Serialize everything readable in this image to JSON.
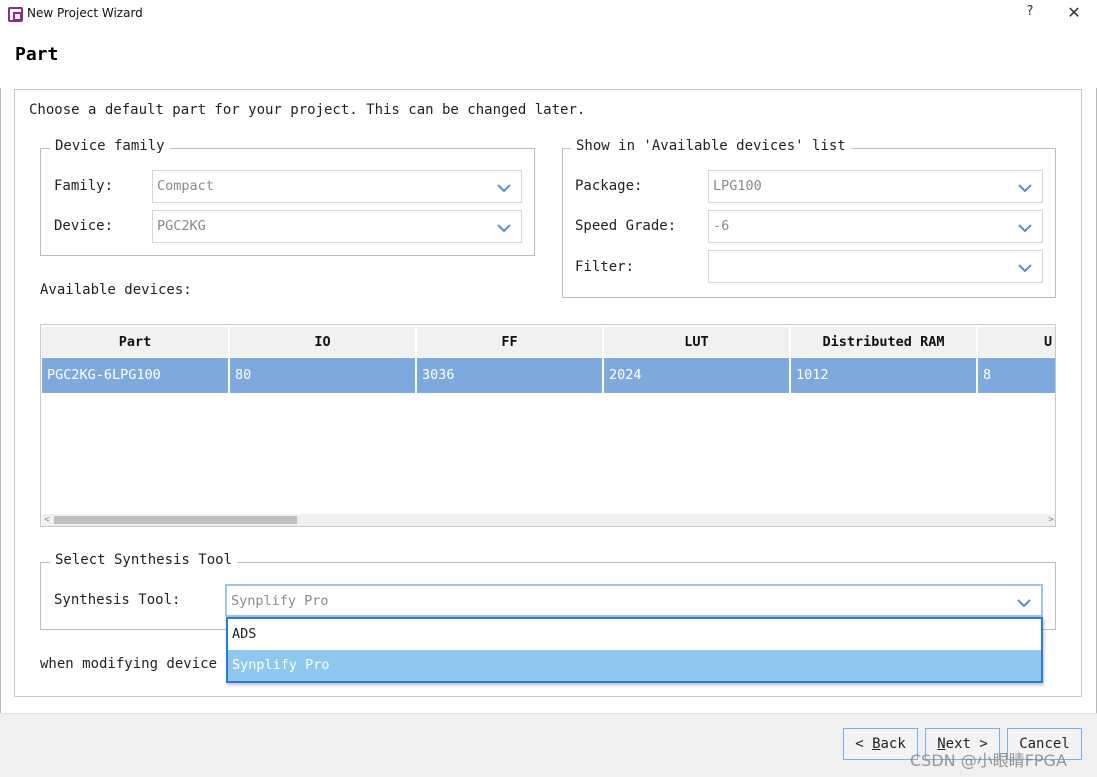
{
  "window": {
    "title": "New Project Wizard",
    "help_label": "?",
    "close_label": "✕"
  },
  "page": {
    "title": "Part",
    "description": "Choose a default part for your project. This can be changed later."
  },
  "device_family": {
    "legend": "Device family",
    "family_label": "Family:",
    "family_value": "Compact",
    "device_label": "Device:",
    "device_value": "PGC2KG"
  },
  "filters": {
    "legend": "Show in 'Available devices' list",
    "package_label": "Package:",
    "package_value": "LPG100",
    "speed_label": "Speed Grade:",
    "speed_value": "-6",
    "filter_label": "Filter:",
    "filter_value": ""
  },
  "devices": {
    "label": "Available devices:",
    "columns": [
      "Part",
      "IO",
      "FF",
      "LUT",
      "Distributed RAM",
      "U"
    ],
    "rows": [
      [
        "PGC2KG-6LPG100",
        "80",
        "3036",
        "2024",
        "1012",
        "8"
      ]
    ],
    "scroll_left": "<",
    "scroll_right": ">"
  },
  "synthesis": {
    "legend": "Select Synthesis Tool",
    "tool_label": "Synthesis Tool:",
    "tool_value": "Synplify Pro",
    "options": [
      "ADS",
      "Synplify Pro"
    ],
    "selected_option": "Synplify Pro"
  },
  "footnote": "when modifying device",
  "buttons": {
    "back_prefix": "< ",
    "back_mnemonic": "B",
    "back_rest": "ack",
    "next_mnemonic": "N",
    "next_rest": "ext >",
    "cancel_label": "Cancel"
  },
  "watermark": "CSDN @小眼睛FPGA",
  "colors": {
    "selection_row": "#7da9dd",
    "dropdown_selected": "#8fc8ef",
    "focus_border": "#2a7be0",
    "app_icon": "#8a2a8a"
  }
}
